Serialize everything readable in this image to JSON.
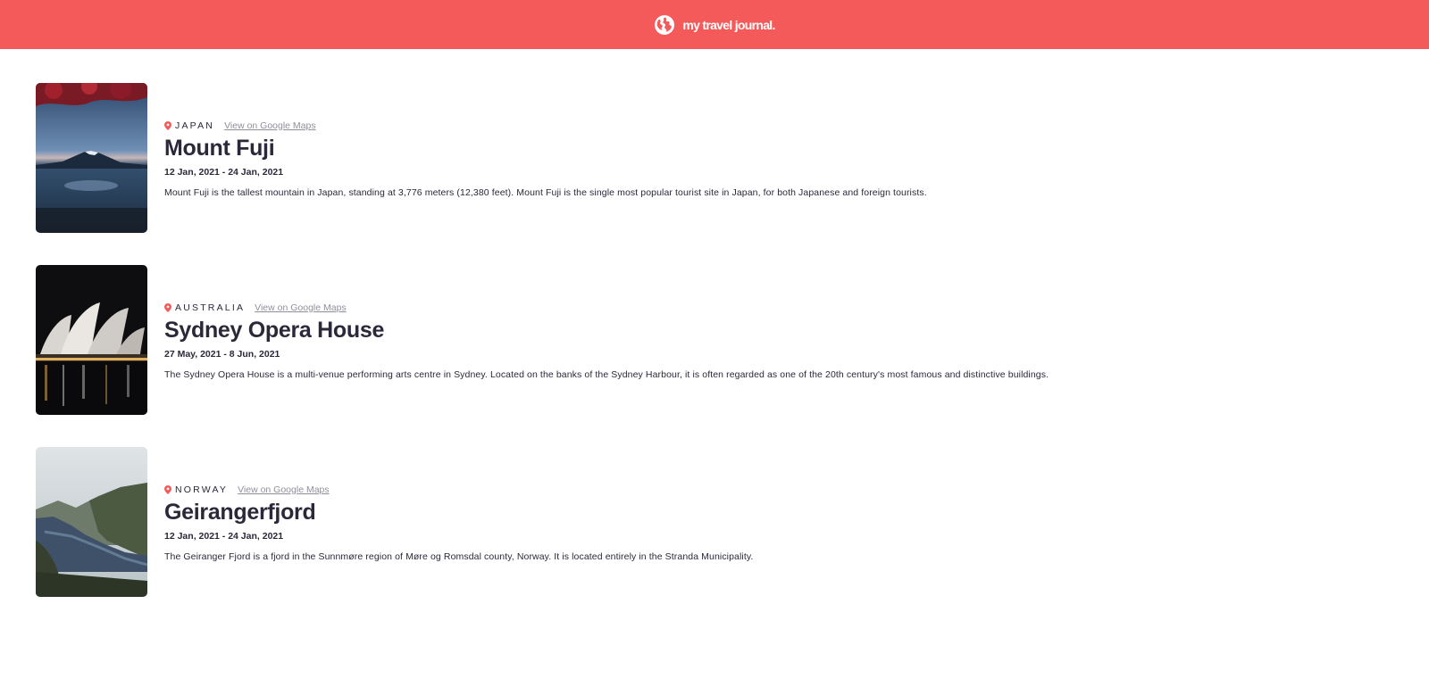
{
  "header": {
    "title": "my travel journal.",
    "icon": "globe-icon",
    "background": "#f55a5a"
  },
  "entries": [
    {
      "country": "JAPAN",
      "maps_link": "View on Google Maps",
      "title": "Mount Fuji",
      "dates": "12 Jan, 2021 - 24 Jan, 2021",
      "description": "Mount Fuji is the tallest mountain in Japan, standing at 3,776 meters (12,380 feet). Mount Fuji is the single most popular tourist site in Japan, for both Japanese and foreign tourists."
    },
    {
      "country": "AUSTRALIA",
      "maps_link": "View on Google Maps",
      "title": "Sydney Opera House",
      "dates": "27 May, 2021 - 8 Jun, 2021",
      "description": "The Sydney Opera House is a multi-venue performing arts centre in Sydney. Located on the banks of the Sydney Harbour, it is often regarded as one of the 20th century's most famous and distinctive buildings."
    },
    {
      "country": "NORWAY",
      "maps_link": "View on Google Maps",
      "title": "Geirangerfjord",
      "dates": "12 Jan, 2021 - 24 Jan, 2021",
      "description": "The Geiranger Fjord is a fjord in the Sunnmøre region of Møre og Romsdal county, Norway. It is located entirely in the Stranda Municipality."
    }
  ],
  "colors": {
    "accent": "#f55a5a",
    "text": "#2b283a",
    "link": "#918e9b"
  }
}
